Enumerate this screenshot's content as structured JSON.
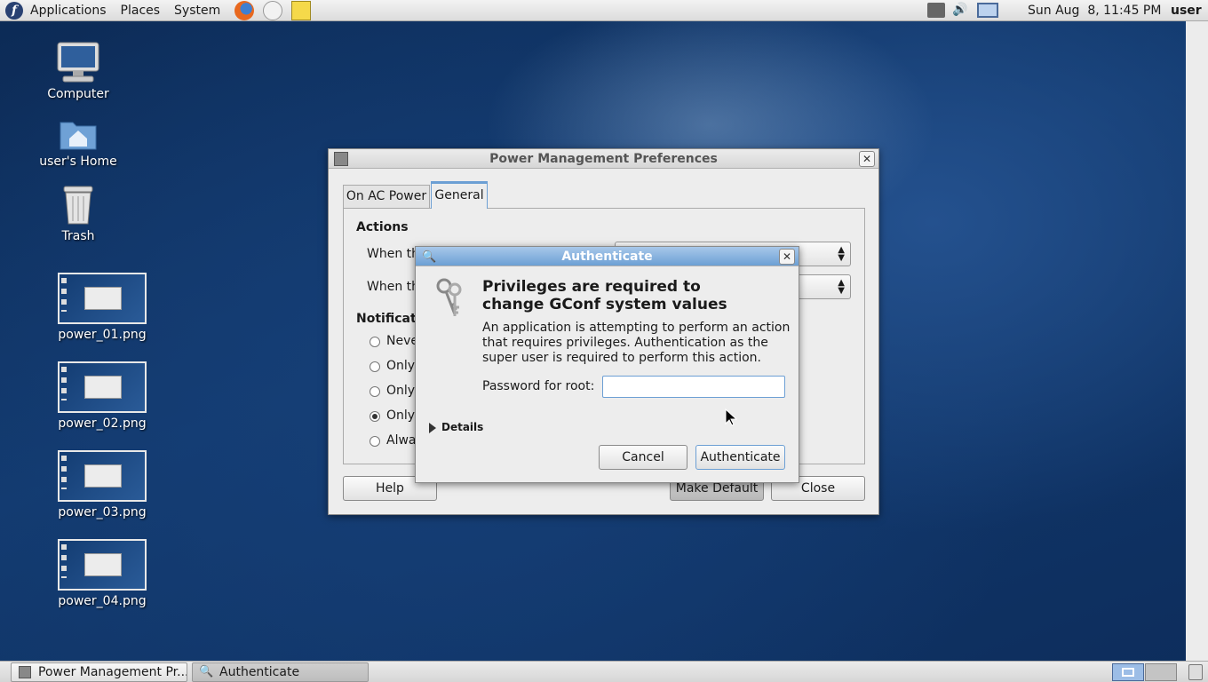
{
  "top_panel": {
    "menus": [
      "Applications",
      "Places",
      "System"
    ],
    "clock": "Sun Aug  8, 11:45 PM",
    "user": "user"
  },
  "desktop_icons": [
    {
      "label": "Computer",
      "icon": "computer-icon"
    },
    {
      "label": "user's Home",
      "icon": "home-folder-icon"
    },
    {
      "label": "Trash",
      "icon": "trash-icon"
    },
    {
      "label": "power_01.png",
      "icon": "image-thumbnail"
    },
    {
      "label": "power_02.png",
      "icon": "image-thumbnail"
    },
    {
      "label": "power_03.png",
      "icon": "image-thumbnail"
    },
    {
      "label": "power_04.png",
      "icon": "image-thumbnail"
    }
  ],
  "power_window": {
    "title": "Power Management Preferences",
    "tabs": [
      "On AC Power",
      "General"
    ],
    "active_tab": "General",
    "actions_heading": "Actions",
    "action_rows": [
      "When th",
      "When th"
    ],
    "notification_heading": "Notificati",
    "radio_options": [
      "Neve",
      "Only",
      "Only",
      "Only",
      "Alwa"
    ],
    "selected_radio": 3,
    "buttons": {
      "help": "Help",
      "make_default": "Make Default",
      "close": "Close"
    }
  },
  "auth_dialog": {
    "title": "Authenticate",
    "heading": "Privileges are required to change GConf system values",
    "heading_line1": "Privileges are required to",
    "heading_line2": "change GConf system values",
    "message": "An application is attempting to perform an action that requires privileges. Authentication as the super user is required to perform this action.",
    "password_label": "Password for root:",
    "password_value": "",
    "details_label": "Details",
    "cancel_label": "Cancel",
    "authenticate_label": "Authenticate"
  },
  "taskbar": {
    "tasks": [
      "Power Management Pr...",
      "Authenticate"
    ]
  },
  "colors": {
    "title_active": "#6c9fd4",
    "desktop": "#163f77"
  }
}
